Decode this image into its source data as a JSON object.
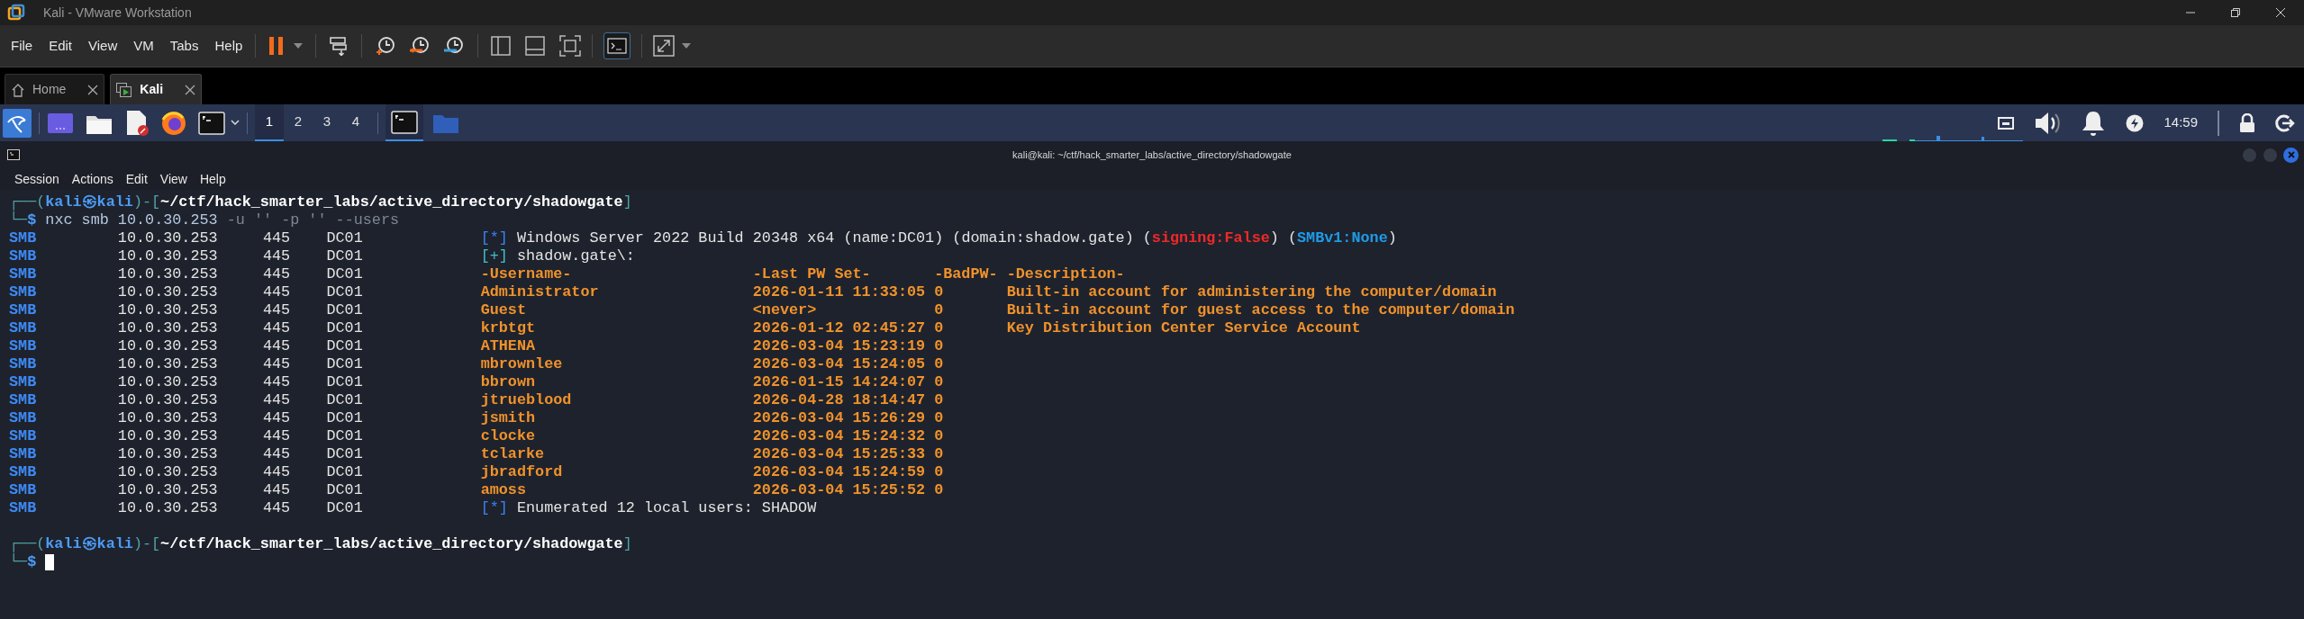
{
  "window": {
    "title": "Kali - VMware Workstation"
  },
  "menu": [
    "File",
    "Edit",
    "View",
    "VM",
    "Tabs",
    "Help"
  ],
  "tabs": [
    {
      "label": "Home",
      "selected": false
    },
    {
      "label": "Kali",
      "selected": true
    }
  ],
  "guest_panel": {
    "workspaces": [
      {
        "label": "1",
        "selected": true
      },
      {
        "label": "2",
        "selected": false
      },
      {
        "label": "3",
        "selected": false
      },
      {
        "label": "4",
        "selected": false
      }
    ],
    "clock": "14:59"
  },
  "terminal": {
    "title": "kali@kali: ~/ctf/hack_smarter_labs/active_directory/shadowgate",
    "menu": [
      "Session",
      "Actions",
      "Edit",
      "View",
      "Help"
    ],
    "cursor": true,
    "lines": [
      {
        "kind": "prompt",
        "parts": [
          {
            "text": "┌──(",
            "kind": "frame"
          },
          {
            "text": "kali㉿kali",
            "kind": "user"
          },
          {
            "text": ")-[",
            "kind": "frame"
          },
          {
            "text": "~/ctf/hack_smarter_labs/active_directory/shadowgate",
            "kind": "path"
          },
          {
            "text": "]",
            "kind": "frame"
          }
        ]
      },
      {
        "kind": "prompt",
        "parts": [
          {
            "text": "└─",
            "kind": "frame"
          },
          {
            "text": "$",
            "kind": "user"
          },
          {
            "text": " nxc smb 10.0.30.253",
            "kind": "command"
          },
          {
            "text": " -u '' -p '' --users",
            "kind": "argument"
          }
        ]
      },
      {
        "kind": "smb_status",
        "cells": [
          "SMB",
          "10.0.30.253",
          "445",
          "DC01"
        ],
        "parts": [
          {
            "text": "[*]",
            "kind": "info"
          },
          {
            "text": " Windows Server 2022 Build 20348 x64 (name:DC01) (domain:shadow.gate) (",
            "kind": "plain"
          },
          {
            "text": "signing:False",
            "kind": "alert"
          },
          {
            "text": ") (",
            "kind": "plain"
          },
          {
            "text": "SMBv1:None",
            "kind": "highlight"
          },
          {
            "text": ")",
            "kind": "plain"
          }
        ]
      },
      {
        "kind": "smb_status",
        "cells": [
          "SMB",
          "10.0.30.253",
          "445",
          "DC01"
        ],
        "parts": [
          {
            "text": "[+]",
            "kind": "ok"
          },
          {
            "text": " shadow.gate\\:",
            "kind": "plain"
          }
        ]
      },
      {
        "kind": "smb_table",
        "cells": [
          "SMB",
          "10.0.30.253",
          "445",
          "DC01"
        ],
        "columns": [
          "-Username-",
          "-Last PW Set-",
          "-BadPW-",
          "-Description-"
        ]
      },
      {
        "kind": "smb_table",
        "cells": [
          "SMB",
          "10.0.30.253",
          "445",
          "DC01"
        ],
        "columns": [
          "Administrator",
          "2026-01-11 11:33:05",
          "0",
          "Built-in account for administering the computer/domain"
        ]
      },
      {
        "kind": "smb_table",
        "cells": [
          "SMB",
          "10.0.30.253",
          "445",
          "DC01"
        ],
        "columns": [
          "Guest",
          "<never>",
          "0",
          "Built-in account for guest access to the computer/domain"
        ]
      },
      {
        "kind": "smb_table",
        "cells": [
          "SMB",
          "10.0.30.253",
          "445",
          "DC01"
        ],
        "columns": [
          "krbtgt",
          "2026-01-12 02:45:27",
          "0",
          "Key Distribution Center Service Account"
        ]
      },
      {
        "kind": "smb_table",
        "cells": [
          "SMB",
          "10.0.30.253",
          "445",
          "DC01"
        ],
        "columns": [
          "ATHENA",
          "2026-03-04 15:23:19",
          "0"
        ]
      },
      {
        "kind": "smb_table",
        "cells": [
          "SMB",
          "10.0.30.253",
          "445",
          "DC01"
        ],
        "columns": [
          "mbrownlee",
          "2026-03-04 15:24:05",
          "0"
        ]
      },
      {
        "kind": "smb_table",
        "cells": [
          "SMB",
          "10.0.30.253",
          "445",
          "DC01"
        ],
        "columns": [
          "bbrown",
          "2026-01-15 14:24:07",
          "0"
        ]
      },
      {
        "kind": "smb_table",
        "cells": [
          "SMB",
          "10.0.30.253",
          "445",
          "DC01"
        ],
        "columns": [
          "jtrueblood",
          "2026-04-28 18:14:47",
          "0"
        ]
      },
      {
        "kind": "smb_table",
        "cells": [
          "SMB",
          "10.0.30.253",
          "445",
          "DC01"
        ],
        "columns": [
          "jsmith",
          "2026-03-04 15:26:29",
          "0"
        ]
      },
      {
        "kind": "smb_table",
        "cells": [
          "SMB",
          "10.0.30.253",
          "445",
          "DC01"
        ],
        "columns": [
          "clocke",
          "2026-03-04 15:24:32",
          "0"
        ]
      },
      {
        "kind": "smb_table",
        "cells": [
          "SMB",
          "10.0.30.253",
          "445",
          "DC01"
        ],
        "columns": [
          "tclarke",
          "2026-03-04 15:25:33",
          "0"
        ]
      },
      {
        "kind": "smb_table",
        "cells": [
          "SMB",
          "10.0.30.253",
          "445",
          "DC01"
        ],
        "columns": [
          "jbradford",
          "2026-03-04 15:24:59",
          "0"
        ]
      },
      {
        "kind": "smb_table",
        "cells": [
          "SMB",
          "10.0.30.253",
          "445",
          "DC01"
        ],
        "columns": [
          "amoss",
          "2026-03-04 15:25:52",
          "0"
        ]
      },
      {
        "kind": "smb_status",
        "cells": [
          "SMB",
          "10.0.30.253",
          "445",
          "DC01"
        ],
        "parts": [
          {
            "text": "[*]",
            "kind": "info"
          },
          {
            "text": " Enumerated 12 local users: SHADOW",
            "kind": "plain"
          }
        ]
      },
      {
        "kind": "blank"
      },
      {
        "kind": "prompt",
        "parts": [
          {
            "text": "┌──(",
            "kind": "frame"
          },
          {
            "text": "kali㉿kali",
            "kind": "user"
          },
          {
            "text": ")-[",
            "kind": "frame"
          },
          {
            "text": "~/ctf/hack_smarter_labs/active_directory/shadowgate",
            "kind": "path"
          },
          {
            "text": "]",
            "kind": "frame"
          }
        ]
      },
      {
        "kind": "prompt",
        "parts": [
          {
            "text": "└─",
            "kind": "frame"
          },
          {
            "text": "$",
            "kind": "user"
          }
        ]
      }
    ]
  }
}
